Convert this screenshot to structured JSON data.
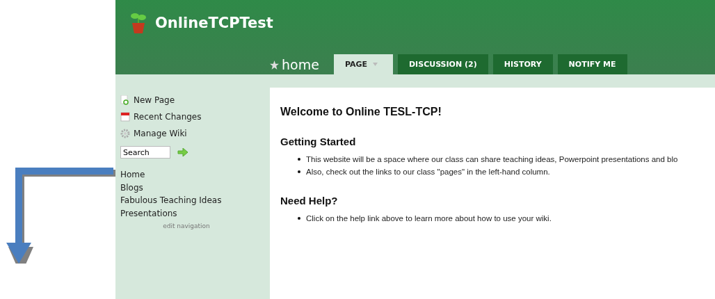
{
  "site": {
    "title": "OnlineTCPTest"
  },
  "page_title": "home",
  "tabs": [
    {
      "label": "PAGE",
      "selected": true,
      "has_menu": true
    },
    {
      "label": "DISCUSSION (2)",
      "selected": false,
      "has_menu": false
    },
    {
      "label": "HISTORY",
      "selected": false,
      "has_menu": false
    },
    {
      "label": "NOTIFY ME",
      "selected": false,
      "has_menu": false
    }
  ],
  "sidebar": {
    "actions": [
      {
        "kind": "new",
        "label": "New Page"
      },
      {
        "kind": "calendar",
        "label": "Recent Changes"
      },
      {
        "kind": "gear",
        "label": "Manage Wiki"
      }
    ],
    "search": {
      "value": "Search"
    },
    "nav": [
      "Home",
      "Blogs",
      "Fabulous Teaching Ideas",
      "Presentations"
    ],
    "edit_link": "edit navigation"
  },
  "content": {
    "heading": "Welcome to Online TESL-TCP!",
    "sections": [
      {
        "heading": "Getting Started",
        "bullets": [
          "This website will be a space where our class can share teaching ideas, Powerpoint presentations and blo",
          "Also, check out the links to our class \"pages\" in the left-hand column."
        ]
      },
      {
        "heading": "Need Help?",
        "bullets": [
          "Click on the help link above to learn more about how to use your wiki."
        ]
      }
    ]
  }
}
